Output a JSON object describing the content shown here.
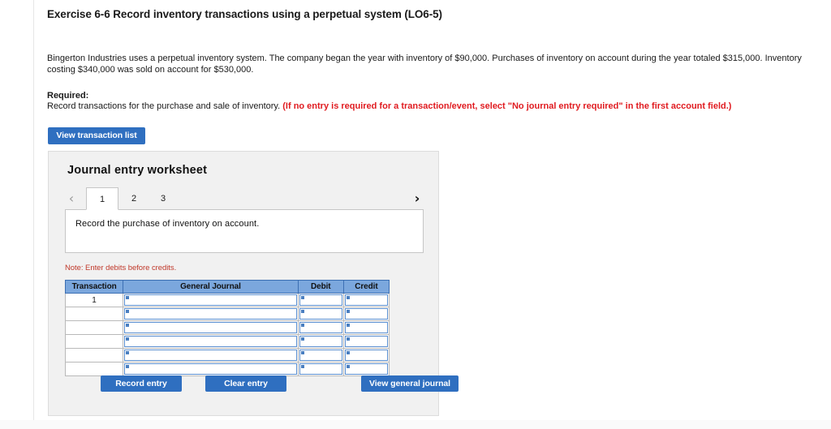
{
  "exercise": {
    "title": "Exercise 6-6 Record inventory transactions using a perpetual system (LO6-5)",
    "problem": "Bingerton Industries uses a perpetual inventory system. The company began the year with inventory of $90,000. Purchases of inventory on account during the year totaled $315,000. Inventory costing $340,000 was sold on account for $530,000.",
    "required_label": "Required:",
    "required_text": "Record transactions for the purchase and sale of inventory.",
    "required_note": "(If no entry is required for a transaction/event, select \"No journal entry required\" in the first account field.)"
  },
  "toolbar": {
    "view_transaction_list": "View transaction list"
  },
  "worksheet": {
    "title": "Journal entry worksheet",
    "prev_arrow": "‹",
    "next_arrow": "›",
    "tabs": [
      {
        "label": "1",
        "active": true
      },
      {
        "label": "2",
        "active": false
      },
      {
        "label": "3",
        "active": false
      }
    ],
    "instruction": "Record the purchase of inventory on account.",
    "note": "Note: Enter debits before credits.",
    "table": {
      "headers": [
        "Transaction",
        "General Journal",
        "Debit",
        "Credit"
      ],
      "rows": [
        {
          "transaction": "1",
          "general_journal": "",
          "debit": "",
          "credit": ""
        },
        {
          "transaction": "",
          "general_journal": "",
          "debit": "",
          "credit": ""
        },
        {
          "transaction": "",
          "general_journal": "",
          "debit": "",
          "credit": ""
        },
        {
          "transaction": "",
          "general_journal": "",
          "debit": "",
          "credit": ""
        },
        {
          "transaction": "",
          "general_journal": "",
          "debit": "",
          "credit": ""
        },
        {
          "transaction": "",
          "general_journal": "",
          "debit": "",
          "credit": ""
        }
      ]
    },
    "buttons": {
      "record_entry": "Record entry",
      "clear_entry": "Clear entry",
      "view_general_journal": "View general journal"
    }
  },
  "colors": {
    "button_blue": "#2f6fc0",
    "table_header_blue": "#7ba7dd",
    "note_red": "#c0392b",
    "required_red": "#e01b20",
    "panel_gray": "#f1f1f1"
  }
}
